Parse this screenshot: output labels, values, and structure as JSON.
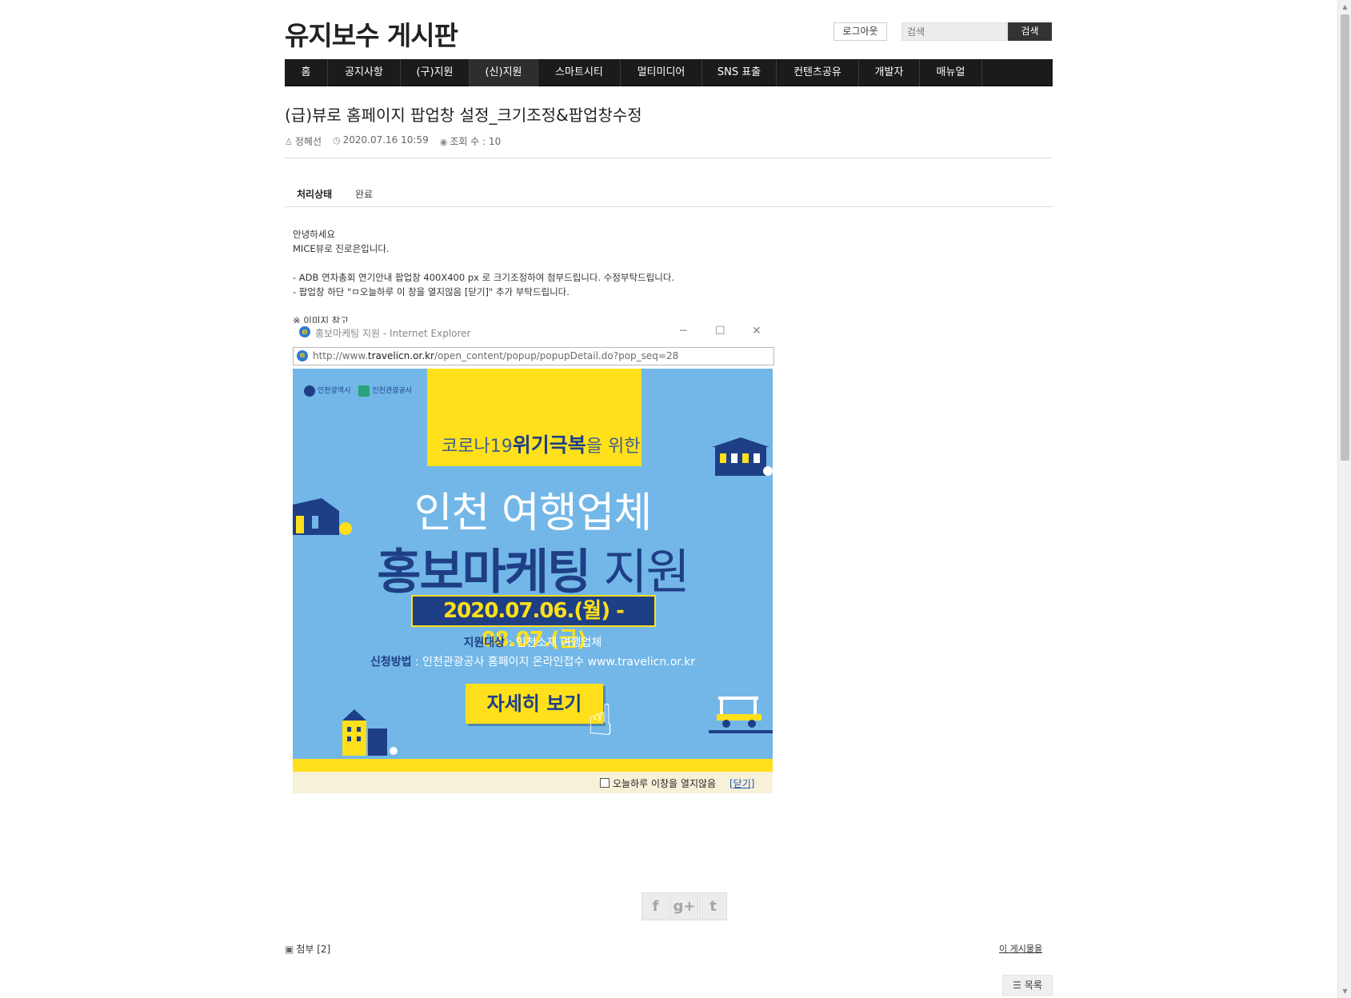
{
  "header": {
    "site_title": "유지보수 게시판",
    "logout_label": "로그아웃",
    "search_placeholder": "검색",
    "search_button": "검색"
  },
  "nav": {
    "items": [
      {
        "label": "홈"
      },
      {
        "label": "공지사항"
      },
      {
        "label": "(구)지원"
      },
      {
        "label": "(신)지원"
      },
      {
        "label": "스마트시티"
      },
      {
        "label": "멀티미디어"
      },
      {
        "label": "SNS 표출"
      },
      {
        "label": "컨텐츠공유"
      },
      {
        "label": "개발자"
      },
      {
        "label": "매뉴얼"
      }
    ]
  },
  "post": {
    "title": "(급)뷰로 홈페이지 팝업창 설정_크기조정&팝업창수정",
    "author": "정혜선",
    "datetime": "2020.07.16 10:59",
    "views": "조회 수 : 10",
    "status_label": "처리상태",
    "status_value": "완료",
    "body": {
      "line1": "안녕하세요",
      "line2": "MICE뷰로 진로은입니다.",
      "line3": "- ADB 연차총회 연기안내 팝업창 400X400 px 로 크기조정하여 첨부드립니다. 수정부탁드립니다.",
      "line4": "- 팝업창 하단 \"ㅁ오늘하루 이 창을 열지않음 [닫기]\" 추가 부탁드립니다.",
      "line5": "※ 이미지 참고"
    }
  },
  "ie_window": {
    "title": "홍보마케팅 지원 - Internet Explorer",
    "url_prefix": "http://www.",
    "url_domain": "travelicn.or.kr",
    "url_path": "/open_content/popup/popupDetail.do?pop_seq=28",
    "banner": {
      "logo1": "인천광역시",
      "logo2": "인천관광공사",
      "tag_pre": "코로나19",
      "tag_bold": "위기극복",
      "tag_post": "을 위한",
      "line1": "인천 여행업체",
      "line2_bold": "홍보마케팅",
      "line2_rest": " 지원",
      "date": "2020.07.06.(월) - 08.07.(금)",
      "info1_label": "지원대상",
      "info1_value": " : 인천소재 여행업체",
      "info2_label": "신청방법",
      "info2_value": " : 인천관광공사 홈페이지 온라인접수 www.travelicn.or.kr",
      "cta": "자세히 보기"
    },
    "footer_text": "오늘하루 이창을 열지않음",
    "footer_close": "[닫기]"
  },
  "footer": {
    "attach_label": "첨부 [2]",
    "post_link": "이 게시물을",
    "list_button": "목록"
  },
  "share": {
    "facebook": "f",
    "google": "g+",
    "twitter": "t"
  }
}
